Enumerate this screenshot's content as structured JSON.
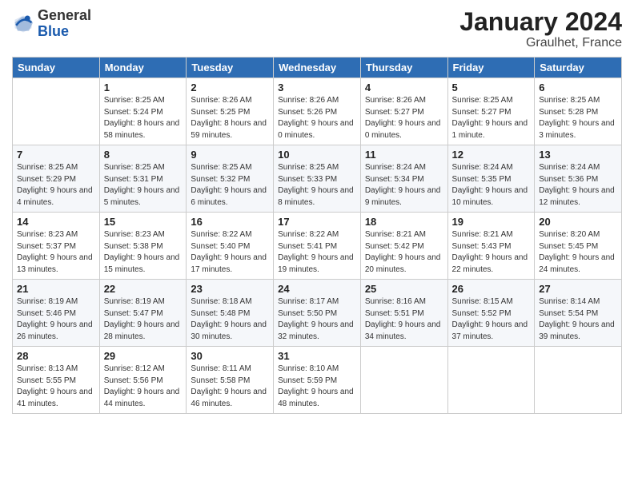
{
  "logo": {
    "general": "General",
    "blue": "Blue"
  },
  "header": {
    "title": "January 2024",
    "subtitle": "Graulhet, France"
  },
  "days_of_week": [
    "Sunday",
    "Monday",
    "Tuesday",
    "Wednesday",
    "Thursday",
    "Friday",
    "Saturday"
  ],
  "weeks": [
    [
      {
        "day": "",
        "sunrise": "",
        "sunset": "",
        "daylight": ""
      },
      {
        "day": "1",
        "sunrise": "Sunrise: 8:25 AM",
        "sunset": "Sunset: 5:24 PM",
        "daylight": "Daylight: 8 hours and 58 minutes."
      },
      {
        "day": "2",
        "sunrise": "Sunrise: 8:26 AM",
        "sunset": "Sunset: 5:25 PM",
        "daylight": "Daylight: 8 hours and 59 minutes."
      },
      {
        "day": "3",
        "sunrise": "Sunrise: 8:26 AM",
        "sunset": "Sunset: 5:26 PM",
        "daylight": "Daylight: 9 hours and 0 minutes."
      },
      {
        "day": "4",
        "sunrise": "Sunrise: 8:26 AM",
        "sunset": "Sunset: 5:27 PM",
        "daylight": "Daylight: 9 hours and 0 minutes."
      },
      {
        "day": "5",
        "sunrise": "Sunrise: 8:25 AM",
        "sunset": "Sunset: 5:27 PM",
        "daylight": "Daylight: 9 hours and 1 minute."
      },
      {
        "day": "6",
        "sunrise": "Sunrise: 8:25 AM",
        "sunset": "Sunset: 5:28 PM",
        "daylight": "Daylight: 9 hours and 3 minutes."
      }
    ],
    [
      {
        "day": "7",
        "sunrise": "Sunrise: 8:25 AM",
        "sunset": "Sunset: 5:29 PM",
        "daylight": "Daylight: 9 hours and 4 minutes."
      },
      {
        "day": "8",
        "sunrise": "Sunrise: 8:25 AM",
        "sunset": "Sunset: 5:31 PM",
        "daylight": "Daylight: 9 hours and 5 minutes."
      },
      {
        "day": "9",
        "sunrise": "Sunrise: 8:25 AM",
        "sunset": "Sunset: 5:32 PM",
        "daylight": "Daylight: 9 hours and 6 minutes."
      },
      {
        "day": "10",
        "sunrise": "Sunrise: 8:25 AM",
        "sunset": "Sunset: 5:33 PM",
        "daylight": "Daylight: 9 hours and 8 minutes."
      },
      {
        "day": "11",
        "sunrise": "Sunrise: 8:24 AM",
        "sunset": "Sunset: 5:34 PM",
        "daylight": "Daylight: 9 hours and 9 minutes."
      },
      {
        "day": "12",
        "sunrise": "Sunrise: 8:24 AM",
        "sunset": "Sunset: 5:35 PM",
        "daylight": "Daylight: 9 hours and 10 minutes."
      },
      {
        "day": "13",
        "sunrise": "Sunrise: 8:24 AM",
        "sunset": "Sunset: 5:36 PM",
        "daylight": "Daylight: 9 hours and 12 minutes."
      }
    ],
    [
      {
        "day": "14",
        "sunrise": "Sunrise: 8:23 AM",
        "sunset": "Sunset: 5:37 PM",
        "daylight": "Daylight: 9 hours and 13 minutes."
      },
      {
        "day": "15",
        "sunrise": "Sunrise: 8:23 AM",
        "sunset": "Sunset: 5:38 PM",
        "daylight": "Daylight: 9 hours and 15 minutes."
      },
      {
        "day": "16",
        "sunrise": "Sunrise: 8:22 AM",
        "sunset": "Sunset: 5:40 PM",
        "daylight": "Daylight: 9 hours and 17 minutes."
      },
      {
        "day": "17",
        "sunrise": "Sunrise: 8:22 AM",
        "sunset": "Sunset: 5:41 PM",
        "daylight": "Daylight: 9 hours and 19 minutes."
      },
      {
        "day": "18",
        "sunrise": "Sunrise: 8:21 AM",
        "sunset": "Sunset: 5:42 PM",
        "daylight": "Daylight: 9 hours and 20 minutes."
      },
      {
        "day": "19",
        "sunrise": "Sunrise: 8:21 AM",
        "sunset": "Sunset: 5:43 PM",
        "daylight": "Daylight: 9 hours and 22 minutes."
      },
      {
        "day": "20",
        "sunrise": "Sunrise: 8:20 AM",
        "sunset": "Sunset: 5:45 PM",
        "daylight": "Daylight: 9 hours and 24 minutes."
      }
    ],
    [
      {
        "day": "21",
        "sunrise": "Sunrise: 8:19 AM",
        "sunset": "Sunset: 5:46 PM",
        "daylight": "Daylight: 9 hours and 26 minutes."
      },
      {
        "day": "22",
        "sunrise": "Sunrise: 8:19 AM",
        "sunset": "Sunset: 5:47 PM",
        "daylight": "Daylight: 9 hours and 28 minutes."
      },
      {
        "day": "23",
        "sunrise": "Sunrise: 8:18 AM",
        "sunset": "Sunset: 5:48 PM",
        "daylight": "Daylight: 9 hours and 30 minutes."
      },
      {
        "day": "24",
        "sunrise": "Sunrise: 8:17 AM",
        "sunset": "Sunset: 5:50 PM",
        "daylight": "Daylight: 9 hours and 32 minutes."
      },
      {
        "day": "25",
        "sunrise": "Sunrise: 8:16 AM",
        "sunset": "Sunset: 5:51 PM",
        "daylight": "Daylight: 9 hours and 34 minutes."
      },
      {
        "day": "26",
        "sunrise": "Sunrise: 8:15 AM",
        "sunset": "Sunset: 5:52 PM",
        "daylight": "Daylight: 9 hours and 37 minutes."
      },
      {
        "day": "27",
        "sunrise": "Sunrise: 8:14 AM",
        "sunset": "Sunset: 5:54 PM",
        "daylight": "Daylight: 9 hours and 39 minutes."
      }
    ],
    [
      {
        "day": "28",
        "sunrise": "Sunrise: 8:13 AM",
        "sunset": "Sunset: 5:55 PM",
        "daylight": "Daylight: 9 hours and 41 minutes."
      },
      {
        "day": "29",
        "sunrise": "Sunrise: 8:12 AM",
        "sunset": "Sunset: 5:56 PM",
        "daylight": "Daylight: 9 hours and 44 minutes."
      },
      {
        "day": "30",
        "sunrise": "Sunrise: 8:11 AM",
        "sunset": "Sunset: 5:58 PM",
        "daylight": "Daylight: 9 hours and 46 minutes."
      },
      {
        "day": "31",
        "sunrise": "Sunrise: 8:10 AM",
        "sunset": "Sunset: 5:59 PM",
        "daylight": "Daylight: 9 hours and 48 minutes."
      },
      {
        "day": "",
        "sunrise": "",
        "sunset": "",
        "daylight": ""
      },
      {
        "day": "",
        "sunrise": "",
        "sunset": "",
        "daylight": ""
      },
      {
        "day": "",
        "sunrise": "",
        "sunset": "",
        "daylight": ""
      }
    ]
  ]
}
